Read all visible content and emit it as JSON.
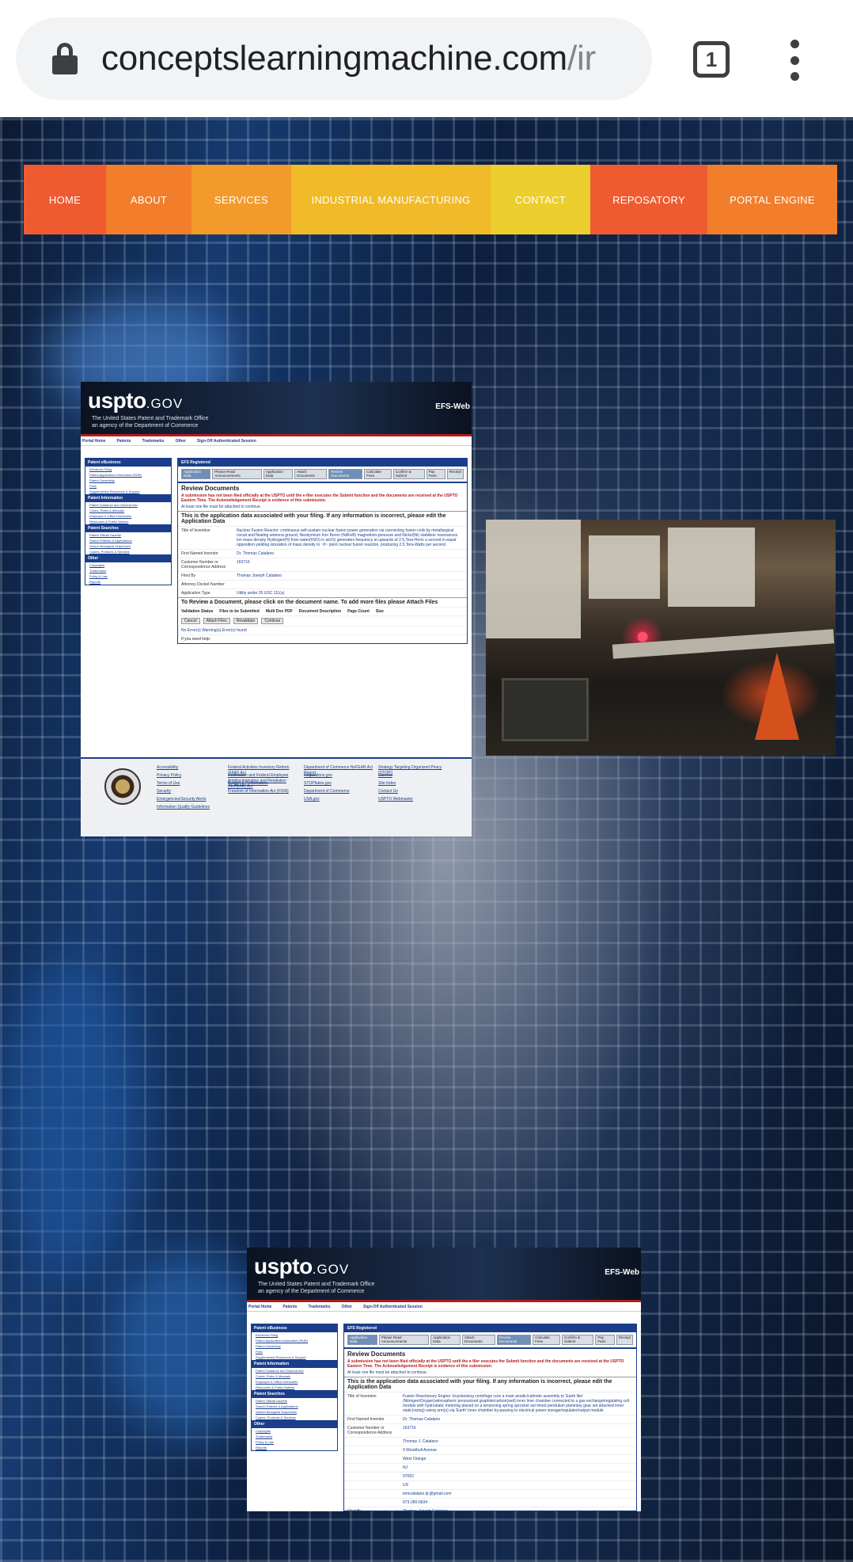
{
  "browser": {
    "url_domain": "conceptslearningmachine.com",
    "url_path": "/ir",
    "tab_count": "1",
    "icons": {
      "lock": "lock-icon",
      "tabs": "tab-switcher-icon",
      "menu": "more-vert-icon"
    }
  },
  "site_nav": {
    "items": [
      {
        "label": "HOME",
        "color": "#ef5b30"
      },
      {
        "label": "ABOUT",
        "color": "#f27d2a"
      },
      {
        "label": "SERVICES",
        "color": "#f29a2a"
      },
      {
        "label": "INDUSTRIAL MANUFACTURING",
        "color": "#f0ba28"
      },
      {
        "label": "CONTACT",
        "color": "#ecce2e"
      },
      {
        "label": "REPOSATORY",
        "color": "#ef5b30"
      },
      {
        "label": "PORTAL ENGINE",
        "color": "#f27d2a"
      }
    ]
  },
  "uspto_card_1": {
    "logo": "uspto",
    "logo_suffix": ".GOV",
    "tagline_1": "The United States Patent and Trademark Office",
    "tagline_2": "an agency of the Department of Commerce",
    "efs": "EFS-Web",
    "topnav": [
      "Portal Home",
      "Patents",
      "Trademarks",
      "Other",
      "Sign-Off Authenticated Session"
    ],
    "sidebar": [
      {
        "heading": "Patent eBusiness",
        "links": [
          "Electronic Filing",
          "Patent Application Information (PAIR)",
          "Patent Ownership",
          "Fees",
          "Supplemental Resources & Support"
        ]
      },
      {
        "heading": "Patent Information",
        "links": [
          "Patent Guidance and General Info",
          "Codes, Rules & Manuals",
          "Employee & Office Directories",
          "Resources & Public Notices"
        ]
      },
      {
        "heading": "Patent Searches",
        "links": [
          "Patent Official Gazette",
          "Search Patents & Applications",
          "Search Biological Sequences",
          "Copies, Products & Services"
        ]
      },
      {
        "heading": "Other",
        "links": [
          "Copyrights",
          "Trademarks",
          "Policy & Law",
          "Reports"
        ]
      }
    ],
    "main_header": "EFS Registered",
    "steps": [
      "Application Data",
      "Please Read Announcements",
      "Application Data",
      "Attach Documents",
      "Review Documents",
      "Calculate Fees",
      "Confirm & Submit",
      "Pay Fees",
      "Receipt"
    ],
    "review_title": "Review Documents",
    "warning": "A submission has not been filed officially at the USPTO until the e-filer executes the Submit function and the documents are received at the USPTO Eastern Time. The Acknowledgement Receipt is evidence of this submission.",
    "note": "At least one file must be attached to continue.",
    "app_data_heading": "This is the application data associated with your filing. If any information is incorrect, please edit the Application Data",
    "fields": [
      {
        "k": "Title of Invention",
        "v": "Nuclear Fusion Reactor: continuous self-sustain nuclear fusion power generation via connecting fusion coils by metallurgical circuit and floating antenna ground, Neodymium Iron Boron (NdFeB) magnetism-pressure and Nickel(Ni) stabilizer resonances ion mass density Hydrogen(H) from water(H2O) in air(O) generates frequency at upwards of 2.5,Tera-Hertz a second in equal opposition yielding ionization of mass density to ~0~ point nuclear fusion reaction, producing 2.5,Tera-Watts per second."
      },
      {
        "k": "First Named Inventor",
        "v": "Dr. Thomas Catalano"
      },
      {
        "k": "Customer Number or Correspondence Address",
        "v": "163716"
      },
      {
        "k": "Filed By",
        "v": "Thomas Joseph Catalano"
      },
      {
        "k": "Attorney Docket Number",
        "v": ""
      },
      {
        "k": "Application Type",
        "v": "Utility under 35 USC 111(a)"
      }
    ],
    "review_doc_heading": "To Review a Document, please click on the document name. To add more files please Attach Files",
    "table_headers": [
      "Validation Status",
      "Files to be Submitted",
      "Multi Doc PDF",
      "Document Description",
      "Page Count",
      "Size"
    ],
    "buttons": [
      "Cancel",
      "Attach Files",
      "Revalidate",
      "Continue"
    ],
    "errors": "No Error(s)  Warning(s)  Error(s) found",
    "help": "If you need help:",
    "footer_links": [
      "Accessibility",
      "Privacy Policy",
      "Terms of Use",
      "Security",
      "Emergencies/Security Alerts",
      "Information Quality Guidelines",
      "Federal Activities Inventory Reform (FAIR) Act",
      "Notification and Federal Employee Antidiscrimination and Retaliation (NoFEAR) Act",
      "Budget & Performance",
      "Freedom of Information Act (FOIA)",
      "Department of Commerce NoFEAR Act Report",
      "Regulations.gov",
      "STOPfakes.gov",
      "Department of Commerce",
      "USA.gov",
      "Strategy Targeting Organized Piracy (STOP!)",
      "Careers",
      "Site Index",
      "Contact Us",
      "USPTO Webmaster"
    ]
  },
  "uspto_card_2": {
    "logo": "uspto",
    "logo_suffix": ".GOV",
    "tagline_1": "The United States Patent and Trademark Office",
    "tagline_2": "an agency of the Department of Commerce",
    "efs": "EFS-Web",
    "topnav": [
      "Portal Home",
      "Patents",
      "Trademarks",
      "Other",
      "Sign-Off Authenticated Session"
    ],
    "main_header": "EFS Registered",
    "steps": [
      "Application Data",
      "Please Read Announcements",
      "Application Data",
      "Attach Documents",
      "Review Documents",
      "Calculate Fees",
      "Confirm & Submit",
      "Pay Fees",
      "Receipt"
    ],
    "review_title": "Review Documents",
    "warning": "A submission has not been filed officially at the USPTO until the e-filer executes the Submit function and the documents are received at the USPTO Eastern Time. The Acknowledgement Receipt is evidence of this submission.",
    "note": "At least one file must be attached to continue.",
    "app_data_heading": "This is the application data associated with your filing. If any information is incorrect, please edit the Application Data",
    "fields": [
      {
        "k": "Title of Invention",
        "v": "Fusion Reactionary Engine: bi-polarizing centrifuge core a mast anodic/cathode assembly to 'Earth like' (Nitrogen/Oxygen)atmospheric pressurized graphite/carbon(sed) inner liner chamber connected to a gas exchange/regulating cell module with hydrostatic metering placed on a tensioning spring sprocket set timed pendulum planetary gear set attached inner static(sizing) swing arm(s) via 'Earth' inner chamber by-passing to electrical power storage/regulator/output module"
      },
      {
        "k": "First Named Inventor",
        "v": "Dr. Thomas Catalano"
      },
      {
        "k": "Customer Number or Correspondence Address",
        "v": "163716"
      },
      {
        "k": "",
        "v": "Thomas J. Catalano"
      },
      {
        "k": "",
        "v": "9 Woodhull Avenue"
      },
      {
        "k": "",
        "v": "West Orange"
      },
      {
        "k": "",
        "v": "NJ"
      },
      {
        "k": "",
        "v": "07052"
      },
      {
        "k": "",
        "v": "US"
      },
      {
        "k": "",
        "v": "tomcatalano.tjc@gmail.com"
      },
      {
        "k": "",
        "v": "973-280-5834"
      },
      {
        "k": "Filed By",
        "v": "Thomas Joseph Catalano"
      }
    ]
  },
  "photo": {
    "subject": "lab-photo-red-light"
  }
}
